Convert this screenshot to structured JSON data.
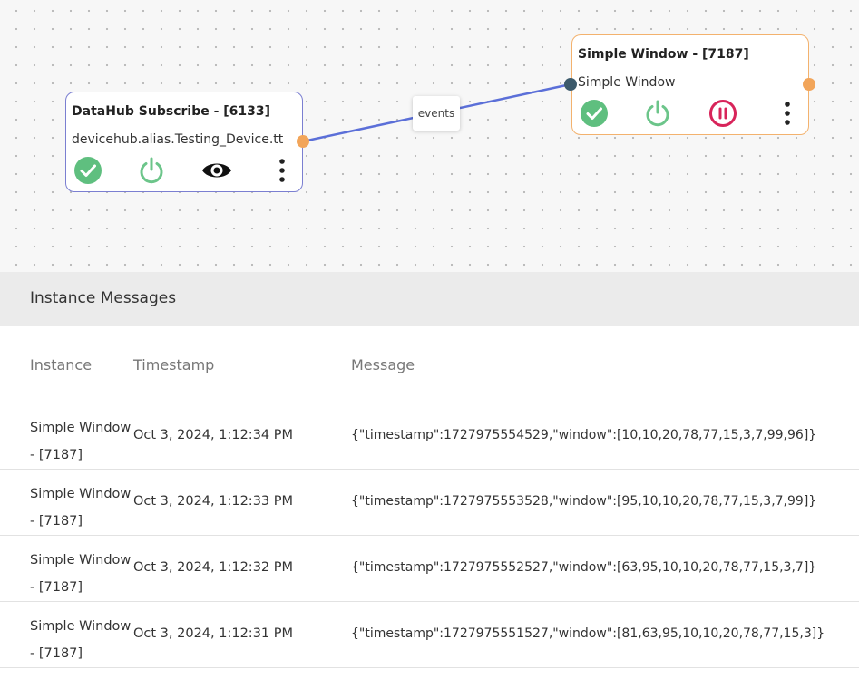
{
  "canvas": {
    "edge_label": "events",
    "nodes": {
      "datahub": {
        "title": "DataHub Subscribe - [6133]",
        "subtitle": "devicehub.alias.Testing_Device.tt",
        "border_color": "#7b7fd1",
        "icons": [
          "check-circle-icon",
          "power-icon",
          "eye-icon",
          "more-vertical-icon"
        ]
      },
      "window": {
        "title": "Simple Window - [7187]",
        "subtitle": "Simple Window",
        "border_color": "#f3b26e",
        "icons": [
          "check-circle-icon",
          "power-icon",
          "pause-circle-icon",
          "more-vertical-icon"
        ]
      }
    },
    "colors": {
      "wire": "#5b6fd8",
      "check": "#5fbf7f",
      "power": "#6cc58a",
      "pause": "#d8245a",
      "output_port": "#f2a55a",
      "input_port": "#3c5a6b"
    }
  },
  "messages": {
    "title": "Instance Messages",
    "columns": {
      "instance": "Instance",
      "timestamp": "Timestamp",
      "message": "Message"
    },
    "rows": [
      {
        "instance": "Simple Window - [7187]",
        "timestamp": "Oct 3, 2024, 1:12:34 PM",
        "message": "{\"timestamp\":1727975554529,\"window\":[10,10,20,78,77,15,3,7,99,96]}"
      },
      {
        "instance": "Simple Window - [7187]",
        "timestamp": "Oct 3, 2024, 1:12:33 PM",
        "message": "{\"timestamp\":1727975553528,\"window\":[95,10,10,20,78,77,15,3,7,99]}"
      },
      {
        "instance": "Simple Window - [7187]",
        "timestamp": "Oct 3, 2024, 1:12:32 PM",
        "message": "{\"timestamp\":1727975552527,\"window\":[63,95,10,10,20,78,77,15,3,7]}"
      },
      {
        "instance": "Simple Window - [7187]",
        "timestamp": "Oct 3, 2024, 1:12:31 PM",
        "message": "{\"timestamp\":1727975551527,\"window\":[81,63,95,10,10,20,78,77,15,3]}"
      }
    ]
  }
}
